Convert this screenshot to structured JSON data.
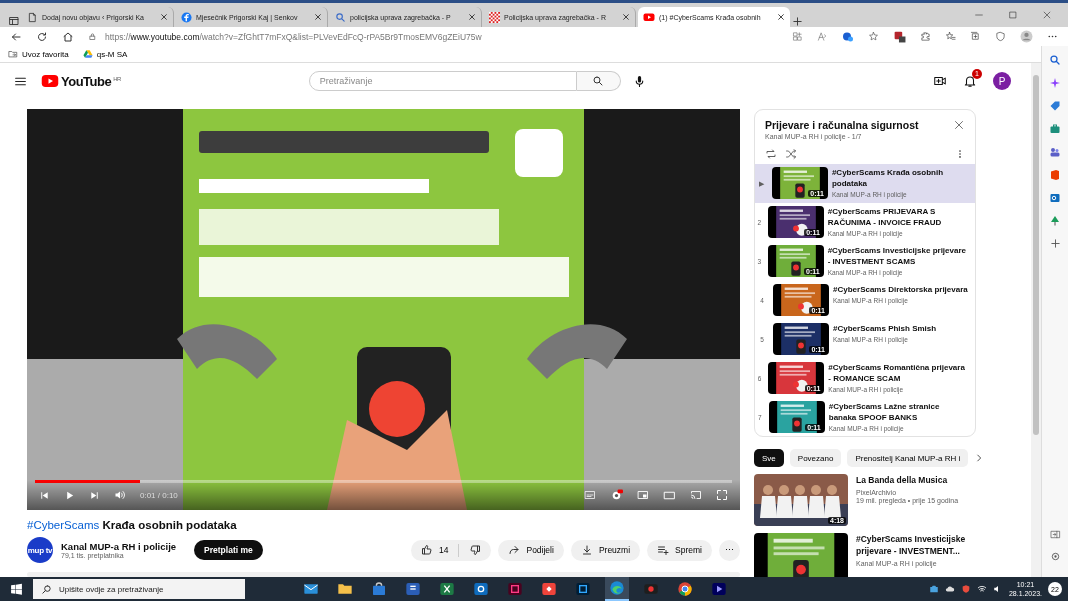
{
  "browser": {
    "tabs": [
      {
        "kind": "page",
        "title": "Dodaj novu objavu ‹ Prigorski Ka",
        "selected": false
      },
      {
        "kind": "f",
        "title": "Mjesečnik Prigorski Kaj | Senkov",
        "selected": false
      },
      {
        "kind": "search",
        "title": "policijska uprava zagrebačka - P",
        "selected": false
      },
      {
        "kind": "checker",
        "title": "Policijska uprava zagrebačka - R",
        "selected": false
      },
      {
        "kind": "play",
        "title": "(1) #CyberScams Krađa osobnih",
        "selected": true
      }
    ],
    "address": "https://**www.youtube.com**/watch?v=ZfGhtT7mFxQ&list=PLVevEdFcQ-rPA5Br9TmosEMV6gZEiU75w",
    "favorites": [
      {
        "kind": "folder",
        "label": "Uvoz favorita"
      },
      {
        "kind": "drive",
        "label": "qs-M SA"
      }
    ]
  },
  "header": {
    "logo": "YouTube",
    "region": "HR",
    "search_placeholder": "Pretraživanje",
    "notifications": "1",
    "avatar": "P"
  },
  "player": {
    "level": 0.15,
    "time": "0:01 / 0:10"
  },
  "video": {
    "tag": "#CyberScams",
    "title": "Krađa osobnih podataka",
    "channel_logo": "mup tv",
    "channel": "Kanal MUP-a RH i policije",
    "subscribers": "79,1 tis. pretplatnika",
    "subscribe": "Pretplati me",
    "likes": "14",
    "actions": [
      {
        "kind": "share",
        "label": "Podijeli"
      },
      {
        "kind": "download",
        "label": "Preuzmi"
      },
      {
        "kind": "save",
        "label": "Spremi"
      }
    ],
    "more": "⋯"
  },
  "playlist": {
    "title": "Prijevare i računalna sigurnost",
    "subtitle": "Kanal MUP-a RH i policije - 1/7",
    "items": [
      {
        "index": "▶",
        "title": "#CyberScams Krađa osobnih podataka",
        "channel": "Kanal MUP-a RH i policije",
        "duration": "0:11",
        "color": "#7db33a",
        "selected": true
      },
      {
        "index": "2",
        "title": "#CyberScams PRIJEVARA S RAČUNIMA - INVOICE FRAUD",
        "channel": "Kanal MUP-a RH i policije",
        "duration": "0:11",
        "color": "#4a2f6e",
        "selected": false
      },
      {
        "index": "3",
        "title": "#CyberScams Investicijske prijevare - INVESTMENT SCAMS",
        "channel": "Kanal MUP-a RH i policije",
        "duration": "0:11",
        "color": "#6fae3a",
        "selected": false
      },
      {
        "index": "4",
        "title": "#CyberScams Direktorska prijevara",
        "channel": "Kanal MUP-a RH i policije",
        "duration": "0:11",
        "color": "#c9661c",
        "selected": false
      },
      {
        "index": "5",
        "title": "#CyberScams Phish Smish",
        "channel": "Kanal MUP-a RH i policije",
        "duration": "0:11",
        "color": "#1c2f66",
        "selected": false
      },
      {
        "index": "6",
        "title": "#CyberScams Romantična prijevara - ROMANCE SCAM",
        "channel": "Kanal MUP-a RH i policije",
        "duration": "0:11",
        "color": "#d8363c",
        "selected": false
      },
      {
        "index": "7",
        "title": "#CyberScams Lažne stranice banaka SPOOF BANKS",
        "channel": "Kanal MUP-a RH i policije",
        "duration": "0:11",
        "color": "#2aa3a0",
        "selected": false
      }
    ]
  },
  "chips": [
    {
      "label": "Sve",
      "selected": true
    },
    {
      "label": "Povezano",
      "selected": false
    },
    {
      "label": "Prenositelj Kanal MUP-a RH i",
      "selected": false
    }
  ],
  "related": [
    {
      "title": "La Banda della Musica",
      "channel": "PixelArchivio",
      "meta": "19 mil. pregleda • prije 15 godina",
      "duration": "4:18",
      "color": "#8a5a48"
    },
    {
      "title": "#CyberScams Investicijske prijevare - INVESTMENT...",
      "channel": "Kanal MUP-a RH i policije",
      "color": "#6fae3a"
    }
  ],
  "taskbar": {
    "search_placeholder": "Upišite ovdje za pretraživanje",
    "apps": [
      {
        "kind": "mail",
        "selected": false
      },
      {
        "kind": "folder",
        "selected": false
      },
      {
        "kind": "store",
        "selected": false
      },
      {
        "kind": "word",
        "selected": false
      },
      {
        "kind": "excel",
        "selected": false
      },
      {
        "kind": "outlook",
        "selected": false
      },
      {
        "kind": "indesign",
        "selected": false
      },
      {
        "kind": "remote",
        "selected": false
      },
      {
        "kind": "photoshop",
        "selected": false
      },
      {
        "kind": "edge",
        "selected": true
      },
      {
        "kind": "recorder",
        "selected": false
      },
      {
        "kind": "chrome",
        "selected": false
      },
      {
        "kind": "premiere",
        "selected": false
      }
    ],
    "time": "10:21",
    "date": "28.1.2023.",
    "notifications": "22"
  }
}
